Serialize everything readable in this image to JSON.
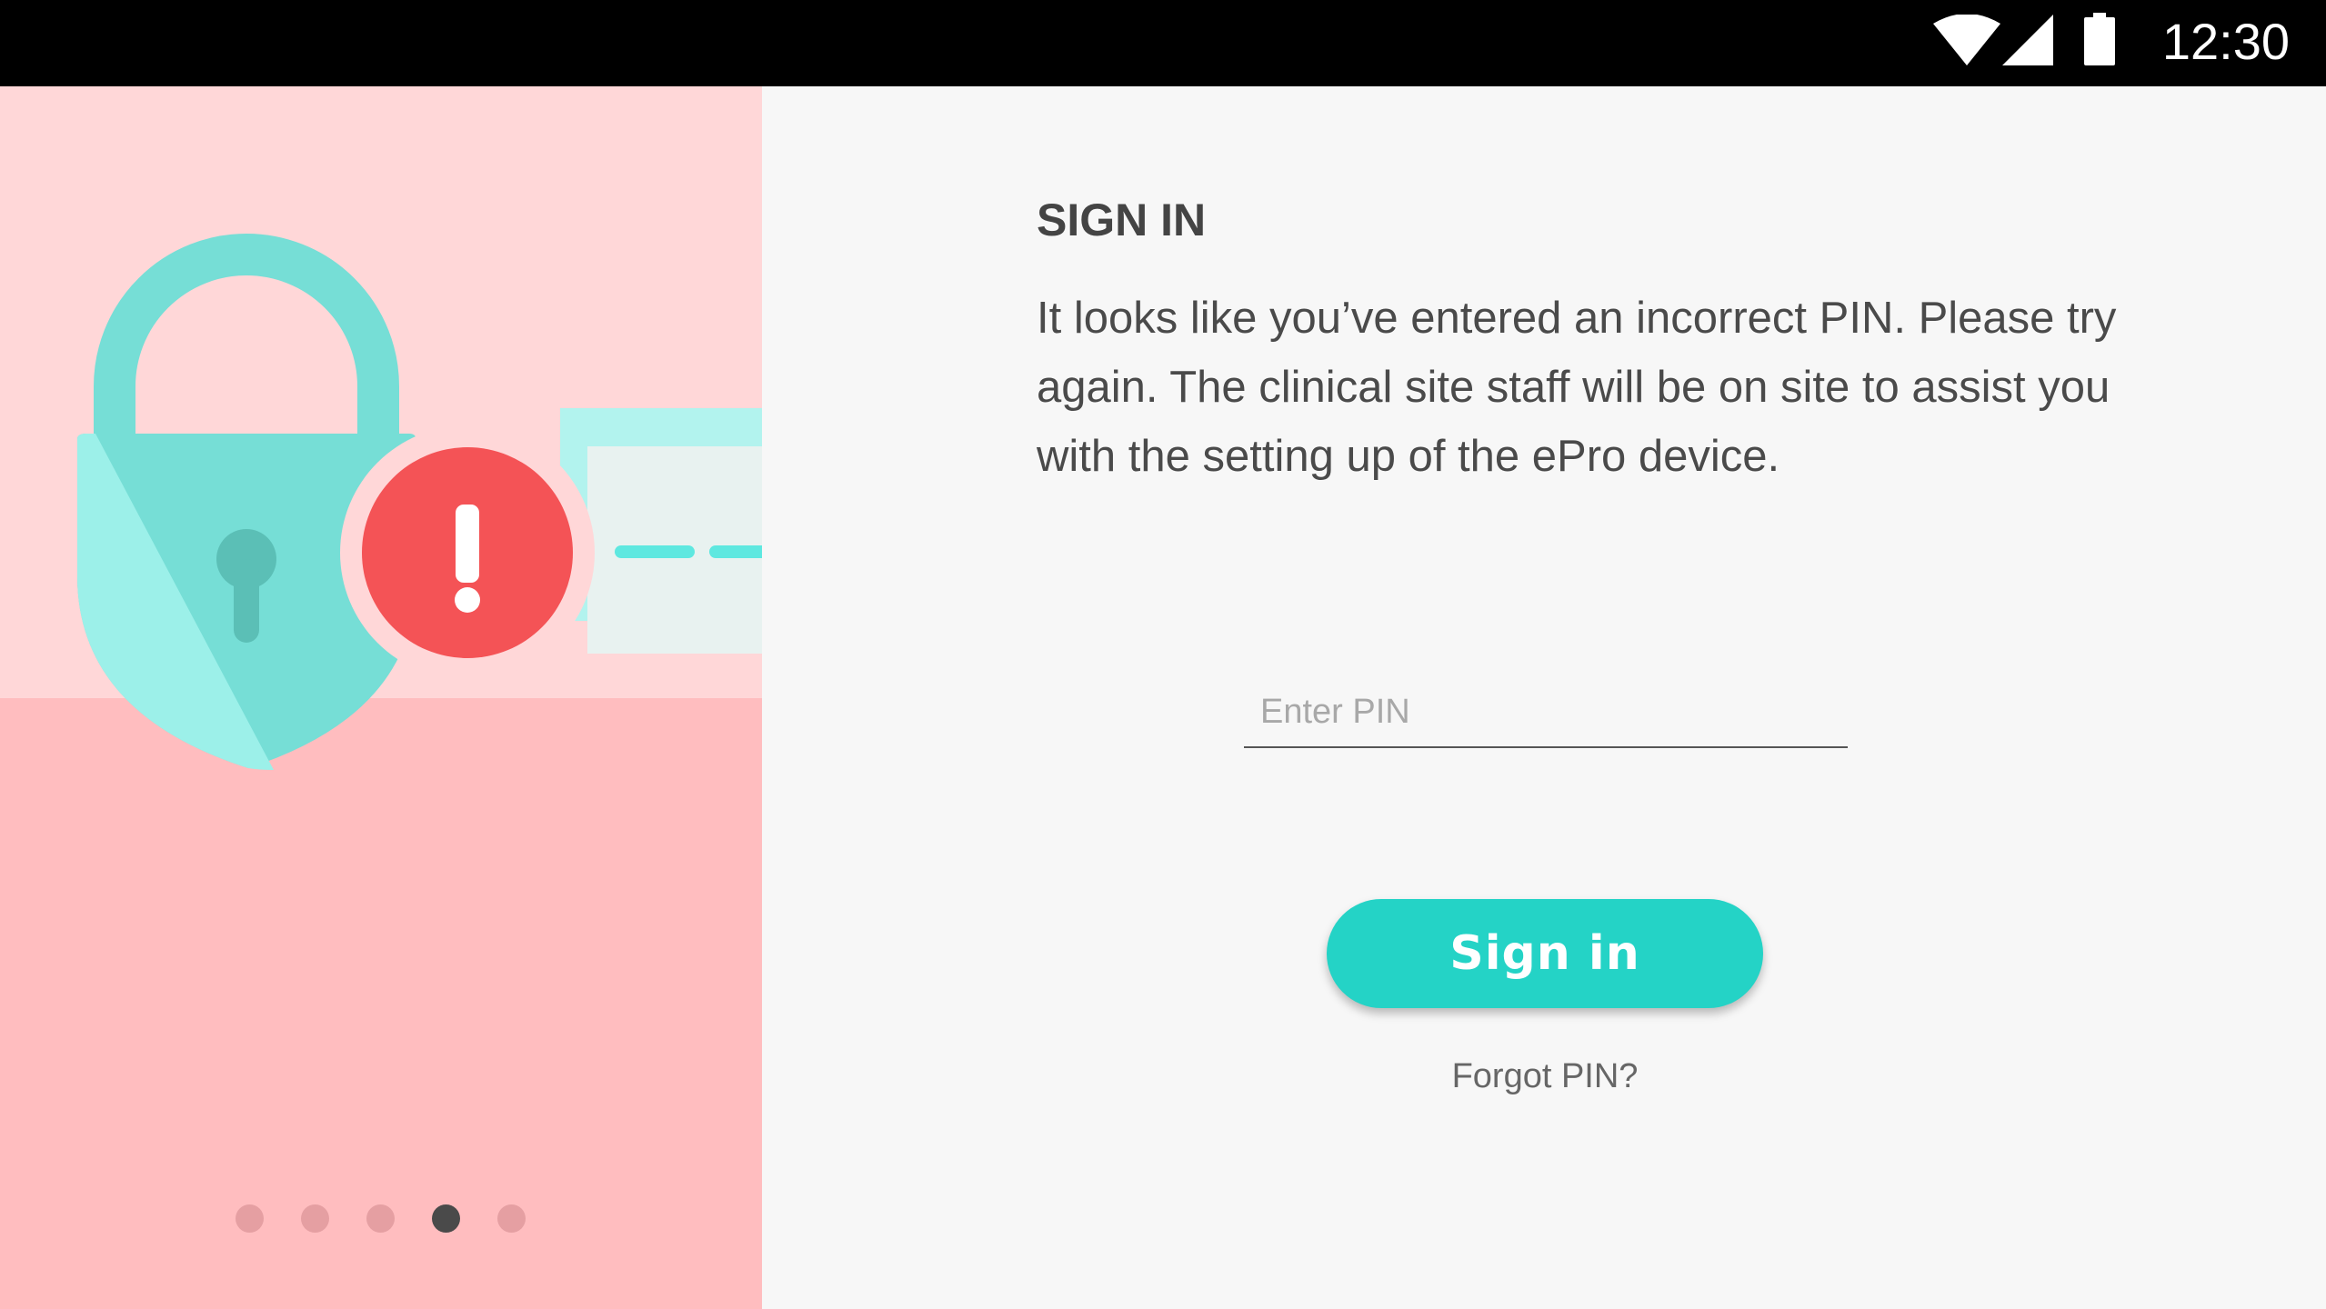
{
  "status_bar": {
    "time": "12:30",
    "icons": [
      "wifi-icon",
      "cellular-signal-icon",
      "battery-icon"
    ]
  },
  "illustration": {
    "icons": [
      "padlock-icon",
      "error-alert-icon",
      "pin-card-icon"
    ],
    "alert_glyph": "!"
  },
  "pager": {
    "count": 5,
    "active_index": 3
  },
  "sign_in": {
    "title": "SIGN IN",
    "message": "It looks like you’ve entered an incorrect PIN. Please try again. The clinical site staff will be on site to assist you with the setting up of the ePro device.",
    "pin_placeholder": "Enter PIN",
    "pin_value": "",
    "button_label": "Sign in",
    "forgot_label": "Forgot PIN?"
  },
  "colors": {
    "accent": "#24d3c6",
    "error": "#f45356",
    "panel_pink": "#ffbdbf",
    "panel_pink_light": "#ffd7d8",
    "lock_teal": "#76ded6",
    "active_dot": "#4a4a4a"
  }
}
